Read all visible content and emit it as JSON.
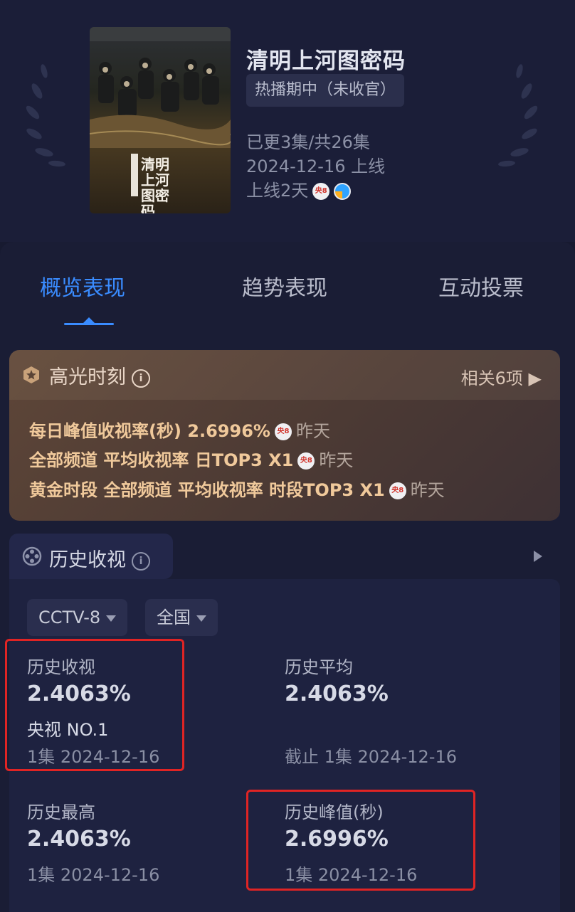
{
  "show": {
    "title": "清明上河图密码",
    "status_badge": "热播期中（未收官）",
    "episodes": "已更3集/共26集",
    "premiere": "2024-12-16 上线",
    "days_online": "上线2天",
    "channel_icon": "央8",
    "poster_title": "清明上河图密码"
  },
  "tabs": [
    {
      "label": "概览表现",
      "active": true
    },
    {
      "label": "趋势表现",
      "active": false
    },
    {
      "label": "互动投票",
      "active": false
    }
  ],
  "highlights": {
    "title": "高光时刻",
    "info": "i",
    "related": "相关6项 ▶",
    "items": [
      {
        "text": "每日峰值收视率(秒) 2.6996%",
        "channel": "央8",
        "when": "昨天"
      },
      {
        "text": "全部频道 平均收视率 日TOP3 X1",
        "channel": "央8",
        "when": "昨天"
      },
      {
        "text": "黄金时段 全部频道 平均收视率 时段TOP3 X1",
        "channel": "央8",
        "when": "昨天"
      }
    ]
  },
  "history": {
    "title": "历史收视",
    "info": "i",
    "filters": {
      "channel": "CCTV-8",
      "region": "全国"
    },
    "stats": [
      {
        "label": "历史收视",
        "value": "2.4063%",
        "rank": "央视 NO.1",
        "date": "1集 2024-12-16"
      },
      {
        "label": "历史平均",
        "value": "2.4063%",
        "date": "截止 1集 2024-12-16"
      },
      {
        "label": "历史最高",
        "value": "2.4063%",
        "date": "1集 2024-12-16"
      },
      {
        "label": "历史峰值(秒)",
        "value": "2.6996%",
        "date": "1集 2024-12-16"
      }
    ]
  },
  "colors": {
    "accent": "#3a8cff",
    "highlight_text": "#f0c99b",
    "annotation_red": "#e02424"
  }
}
